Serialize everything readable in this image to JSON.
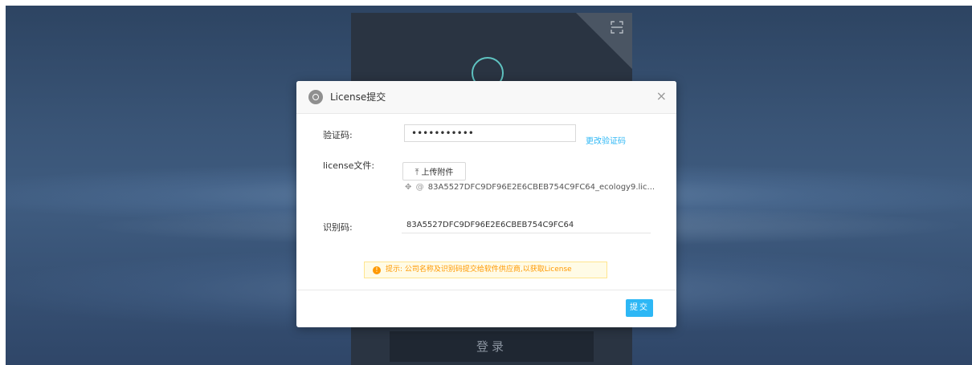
{
  "dialog": {
    "title": "License提交",
    "close_glyph": "×"
  },
  "form": {
    "verify_code_label": "验证码:",
    "verify_code_value": "•••••••••••",
    "change_code_link": "更改验证码",
    "license_file_label": "license文件:",
    "upload_label": "上传附件",
    "upload_icon_glyph": "⤒",
    "file_drag_glyph": "✥",
    "file_clip_glyph": "@",
    "file_name": "83A5527DFC9DF96E2E6CBEB754C9FC64_ecology9.lic...",
    "id_code_label": "识别码:",
    "id_code_value": "83A5527DFC9DF96E2E6CBEB754C9FC64"
  },
  "tip": {
    "icon_glyph": "!",
    "text": "提示: 公司名称及识别码提交给软件供应商,以获取License"
  },
  "footer": {
    "submit_label": "提交"
  },
  "background": {
    "login_button_label": "登录"
  },
  "colors": {
    "accent": "#2db7f5",
    "warning": "#ff9900",
    "login_panel": "#2a3442"
  }
}
